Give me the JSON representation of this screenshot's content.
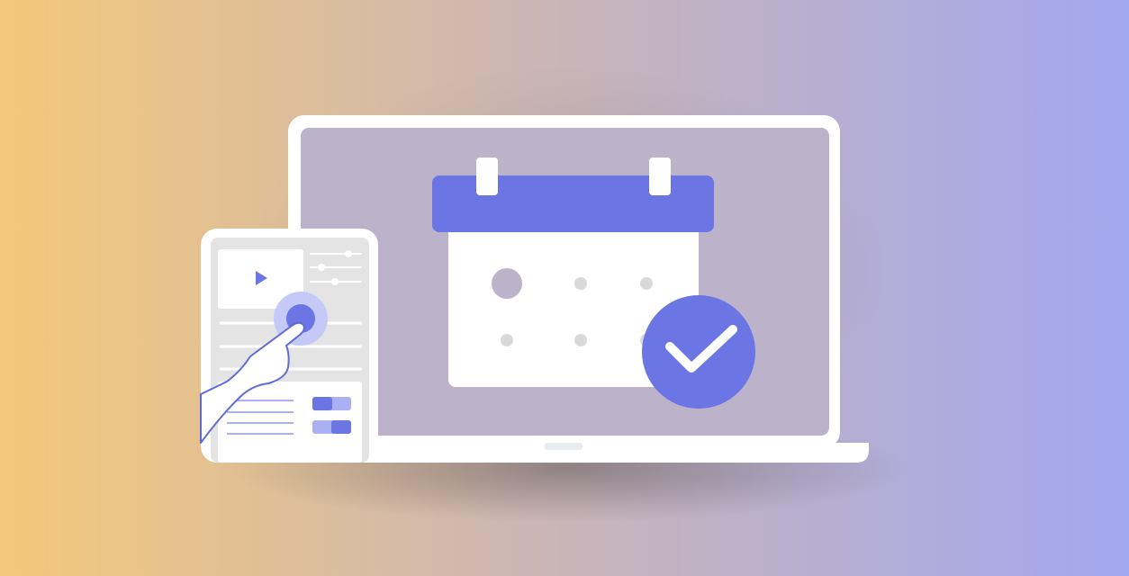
{
  "scene": {
    "description_free": true,
    "colors": {
      "background_left": "#f4c87a",
      "background_mid": "#c9b5b8",
      "background_right": "#a2a8ef",
      "screen_fill": "#bcb3cb",
      "accent": "#6b76e4",
      "accent_light": "#aab0f3",
      "accent_halo": "#c4c9f8",
      "white": "#ffffff",
      "frame": "#ffffff",
      "dot_grey": "#d9d9d9",
      "dot_large": "#bcb3cb",
      "tablet_screen": "#e4e4e4"
    }
  },
  "laptop": {
    "icon": "laptop-icon"
  },
  "calendar": {
    "icon": "calendar-icon",
    "check_icon": "checkmark-icon"
  },
  "tablet": {
    "icon": "tablet-icon",
    "play_icon": "play-icon",
    "toggles": [
      {
        "state": "off"
      },
      {
        "state": "on"
      }
    ]
  },
  "hand": {
    "icon": "pointing-hand-icon"
  }
}
